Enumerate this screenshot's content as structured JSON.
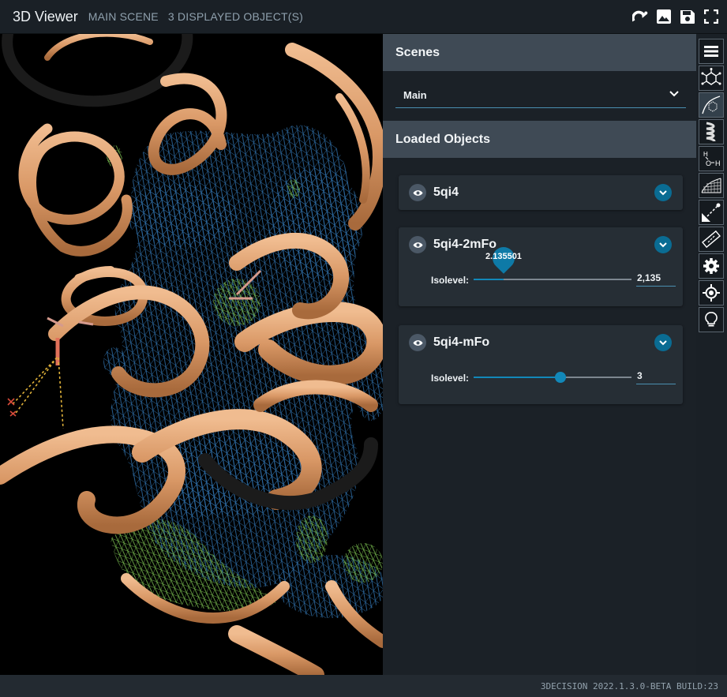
{
  "header": {
    "title": "3D Viewer",
    "scene_crumb": "MAIN SCENE",
    "objects_crumb": "3 DISPLAYED OBJECT(S)",
    "actions": [
      {
        "icon": "rotate-icon"
      },
      {
        "icon": "image-icon"
      },
      {
        "icon": "save-icon"
      },
      {
        "icon": "fullscreen-icon"
      }
    ]
  },
  "viewport": {
    "ribbon_color": "#e1a77a",
    "mesh_blue": "#2f6fa8",
    "mesh_green": "#72b24a"
  },
  "panel": {
    "scenes_title": "Scenes",
    "scene_selected": "Main",
    "loaded_title": "Loaded Objects",
    "objects": [
      {
        "name": "5qi4"
      },
      {
        "name": "5qi4-2mFo",
        "iso_label": "Isolevel:",
        "tooltip": "2.135501",
        "input": "2,135",
        "level": 0.19
      },
      {
        "name": "5qi4-mFo",
        "iso_label": "Isolevel:",
        "input": "3",
        "level": 0.55
      }
    ]
  },
  "toolbar": {
    "tools": [
      {
        "icon": "menu-icon"
      },
      {
        "icon": "molecule-icon"
      },
      {
        "icon": "ligand-icon"
      },
      {
        "icon": "helix-icon"
      },
      {
        "icon": "hydrogen-icon"
      },
      {
        "icon": "surface-icon"
      },
      {
        "icon": "distance-icon"
      },
      {
        "icon": "ruler-icon"
      },
      {
        "icon": "settings-icon"
      },
      {
        "icon": "target-icon"
      },
      {
        "icon": "lightbulb-icon"
      }
    ]
  },
  "footer": {
    "build": "3DECISION 2022.1.3.0-BETA BUILD:23"
  },
  "colors": {
    "accent": "#0a6c93",
    "panel_header": "#3f4a55",
    "card": "#262e35"
  }
}
